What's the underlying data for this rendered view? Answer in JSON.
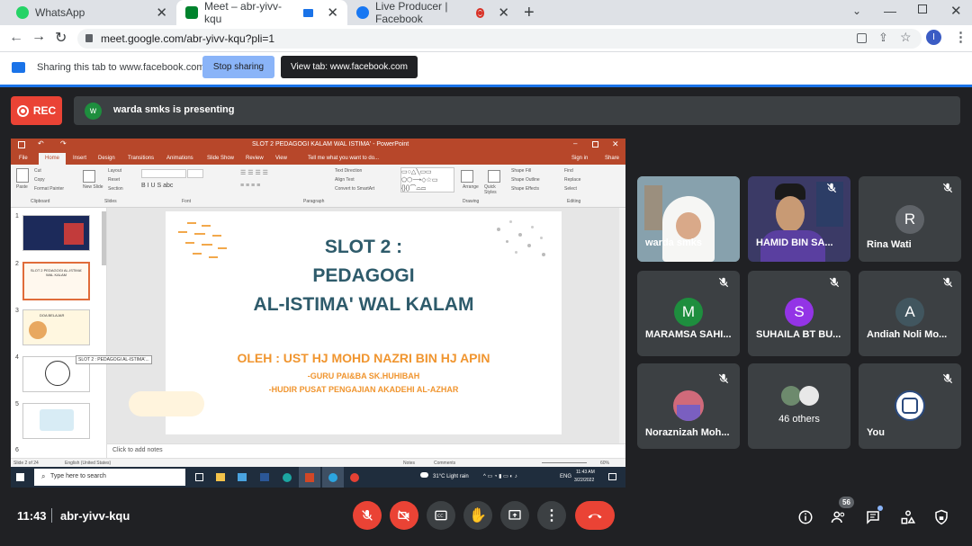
{
  "browser": {
    "tabs": [
      {
        "title": "WhatsApp",
        "color": "#25d366"
      },
      {
        "title": "Meet – abr-yivv-kqu",
        "color": "#00832d"
      },
      {
        "title": "Live Producer | Facebook",
        "color": "#1877f2"
      }
    ],
    "new_tab": "+",
    "url": "meet.google.com/abr-yivv-kqu?pli=1",
    "profile_initial": "I"
  },
  "sharing_bar": {
    "text": "Sharing this tab to www.facebook.com",
    "stop_label": "Stop sharing",
    "view_label": "View tab: www.facebook.com"
  },
  "meet": {
    "rec_label": "REC",
    "presenter_initial": "w",
    "presenting_text": "warda smks is presenting",
    "time": "11:43",
    "meeting_code": "abr-yivv-kqu",
    "people_count": "56",
    "participants": [
      {
        "name": "warda smks",
        "type": "video",
        "muted": false
      },
      {
        "name": "HAMID BIN SA...",
        "type": "video",
        "muted": true
      },
      {
        "name": "Rina Wati",
        "initial": "R",
        "color": "#5f6368",
        "muted": true
      },
      {
        "name": "MARAMSA SAHI...",
        "initial": "M",
        "color": "#1e8e3e",
        "muted": true
      },
      {
        "name": "SUHAILA BT BU...",
        "initial": "S",
        "color": "#9334e6",
        "muted": true
      },
      {
        "name": "Andiah Noli Mo...",
        "initial": "A",
        "color": "#41565f",
        "muted": true
      },
      {
        "name": "Noraznizah Moh...",
        "type": "photo",
        "muted": true
      },
      {
        "name": "46 others",
        "type": "others"
      },
      {
        "name": "You",
        "type": "photo",
        "muted": true
      }
    ]
  },
  "powerpoint": {
    "title": "SLOT 2 PEDAGOGI KALAM WAL ISTIMA' - PowerPoint",
    "signin": "Sign in",
    "share": "Share",
    "ribbon_tabs": [
      "File",
      "Home",
      "Insert",
      "Design",
      "Transitions",
      "Animations",
      "Slide Show",
      "Review",
      "View"
    ],
    "tell_me": "Tell me what you want to do...",
    "groups": [
      "Clipboard",
      "Slides",
      "Font",
      "Paragraph",
      "Drawing",
      "Editing"
    ],
    "clipboard_items": [
      "Paste",
      "Cut",
      "Copy",
      "Format Painter"
    ],
    "slides_items": [
      "New Slide",
      "Layout",
      "Reset",
      "Section"
    ],
    "paragraph_items": [
      "Text Direction",
      "Align Text",
      "Convert to SmartArt"
    ],
    "drawing_items": [
      "Arrange",
      "Quick Styles",
      "Shape Fill",
      "Shape Outline",
      "Shape Effects"
    ],
    "editing_items": [
      "Find",
      "Replace",
      "Select"
    ],
    "thumb_tooltip": "SLOT 2 : PEDAGOGI AL-ISTIMA'...",
    "thumb_numbers": [
      "1",
      "2",
      "3",
      "4",
      "5",
      "6"
    ],
    "thumb_labels": [
      "SLOT 2 PEDAGOGI AL-ISTIMA' WAL KALAM",
      "DOA BELAJAR"
    ],
    "slide": {
      "line1": "SLOT 2 :",
      "line2": "PEDAGOGI",
      "line3": "AL-ISTIMA' WAL KALAM",
      "author": "OLEH : UST HJ MOHD NAZRI BIN HJ APIN",
      "role1": "-GURU PAI&BA SK.HUHIBAH",
      "role2": "-HUDIR PUSAT PENGAJIAN AKADEHI AL-AZHAR"
    },
    "notes": "Click to add notes",
    "status_left": "Slide 2 of 24",
    "status_lang": "English (United States)",
    "status_notes": "Notes",
    "status_comments": "Comments",
    "zoom": "60%"
  },
  "taskbar": {
    "search": "Type here to search",
    "weather": "31°C  Light rain",
    "lang": "ENG",
    "time": "11:43 AM",
    "date": "3/22/2022"
  }
}
